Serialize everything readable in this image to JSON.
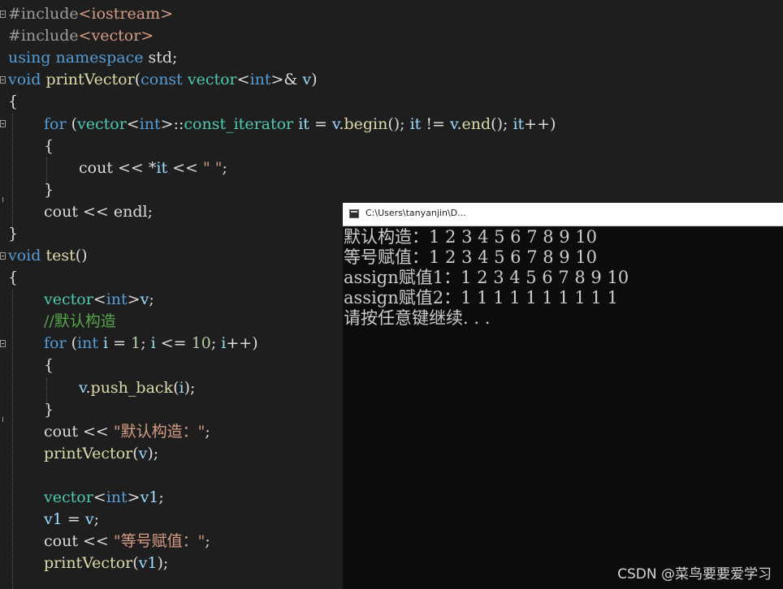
{
  "editor": {
    "code": {
      "l1": {
        "pp": "#include",
        "arg": "<iostream>"
      },
      "l2": {
        "pp": "#include",
        "arg": "<vector>"
      },
      "l3": {
        "kw1": "using",
        "kw2": "namespace",
        "rest": " std;"
      },
      "l4": {
        "kw1": "void",
        "fn": "printVector",
        "p1": "(",
        "kw2": "const",
        "ty": "vector",
        "t2": "<",
        "kw3": "int",
        "t3": ">& ",
        "var": "v",
        "t4": ")"
      },
      "l5": {
        "t": "{"
      },
      "l6": {
        "kw": "for",
        "a": " (",
        "ty": "vector",
        "b": "<",
        "kw2": "int",
        "c": ">::",
        "ty2": "const_iterator",
        "d": " ",
        "var": "it",
        "e": " = ",
        "var2": "v",
        "f": ".",
        "fn": "begin",
        "g": "(); ",
        "var3": "it",
        "h": " != ",
        "var4": "v",
        "i": ".",
        "fn2": "end",
        "j": "(); ",
        "var5": "it",
        "k": "++)"
      },
      "l7": {
        "t": "{"
      },
      "l8": {
        "a": "cout << *",
        "var": "it",
        "b": " << ",
        "str": "\" \"",
        "c": ";"
      },
      "l9": {
        "t": "}"
      },
      "l10": {
        "t": "cout << endl;"
      },
      "l11": {
        "t": "}"
      },
      "l12": {
        "kw": "void",
        "fn": "test",
        "t": "()"
      },
      "l13": {
        "t": "{"
      },
      "l14": {
        "ty": "vector",
        "a": "<",
        "kw": "int",
        "b": ">",
        "var": "v",
        "c": ";"
      },
      "l15": {
        "cm": "//默认构造"
      },
      "l16": {
        "kw": "for",
        "a": " (",
        "kw2": "int",
        "b": " ",
        "var": "i",
        "c": " = ",
        "num": "1",
        "d": "; ",
        "var2": "i",
        "e": " <= ",
        "num2": "10",
        "f": "; ",
        "var3": "i",
        "g": "++)"
      },
      "l17": {
        "t": "{"
      },
      "l18": {
        "var": "v",
        "a": ".",
        "fn": "push_back",
        "b": "(",
        "var2": "i",
        "c": ");"
      },
      "l19": {
        "t": "}"
      },
      "l20": {
        "a": "cout << ",
        "str": "\"默认构造：\"",
        "b": ";"
      },
      "l21": {
        "fn": "printVector",
        "a": "(",
        "var": "v",
        "b": ");"
      },
      "l22": {
        "ty": "vector",
        "a": "<",
        "kw": "int",
        "b": ">",
        "var": "v1",
        "c": ";"
      },
      "l23": {
        "var": "v1",
        "a": " = ",
        "var2": "v",
        "b": ";"
      },
      "l24": {
        "a": "cout << ",
        "str": "\"等号赋值：\"",
        "b": ";"
      },
      "l25": {
        "fn": "printVector",
        "a": "(",
        "var": "v1",
        "b": ");"
      }
    }
  },
  "console": {
    "title": "C:\\Users\\tanyanjin\\D...",
    "lines": [
      "默认构造：1 2 3 4 5 6 7 8 9 10",
      "等号赋值：1 2 3 4 5 6 7 8 9 10",
      "assign赋值1：1 2 3 4 5 6 7 8 9 10",
      "assign赋值2：1 1 1 1 1 1 1 1 1 1",
      "请按任意键继续. . ."
    ]
  },
  "watermark": "CSDN @菜鸟要要爱学习",
  "colors": {
    "editor_bg": "#1e1e1e",
    "keyword": "#569cd6",
    "type": "#4ec9b0",
    "function": "#dcdcaa",
    "string": "#d69d85",
    "comment": "#57a64a",
    "variable": "#9cdcfe",
    "number": "#b5cea8",
    "console_bg": "#0c0c0c"
  }
}
